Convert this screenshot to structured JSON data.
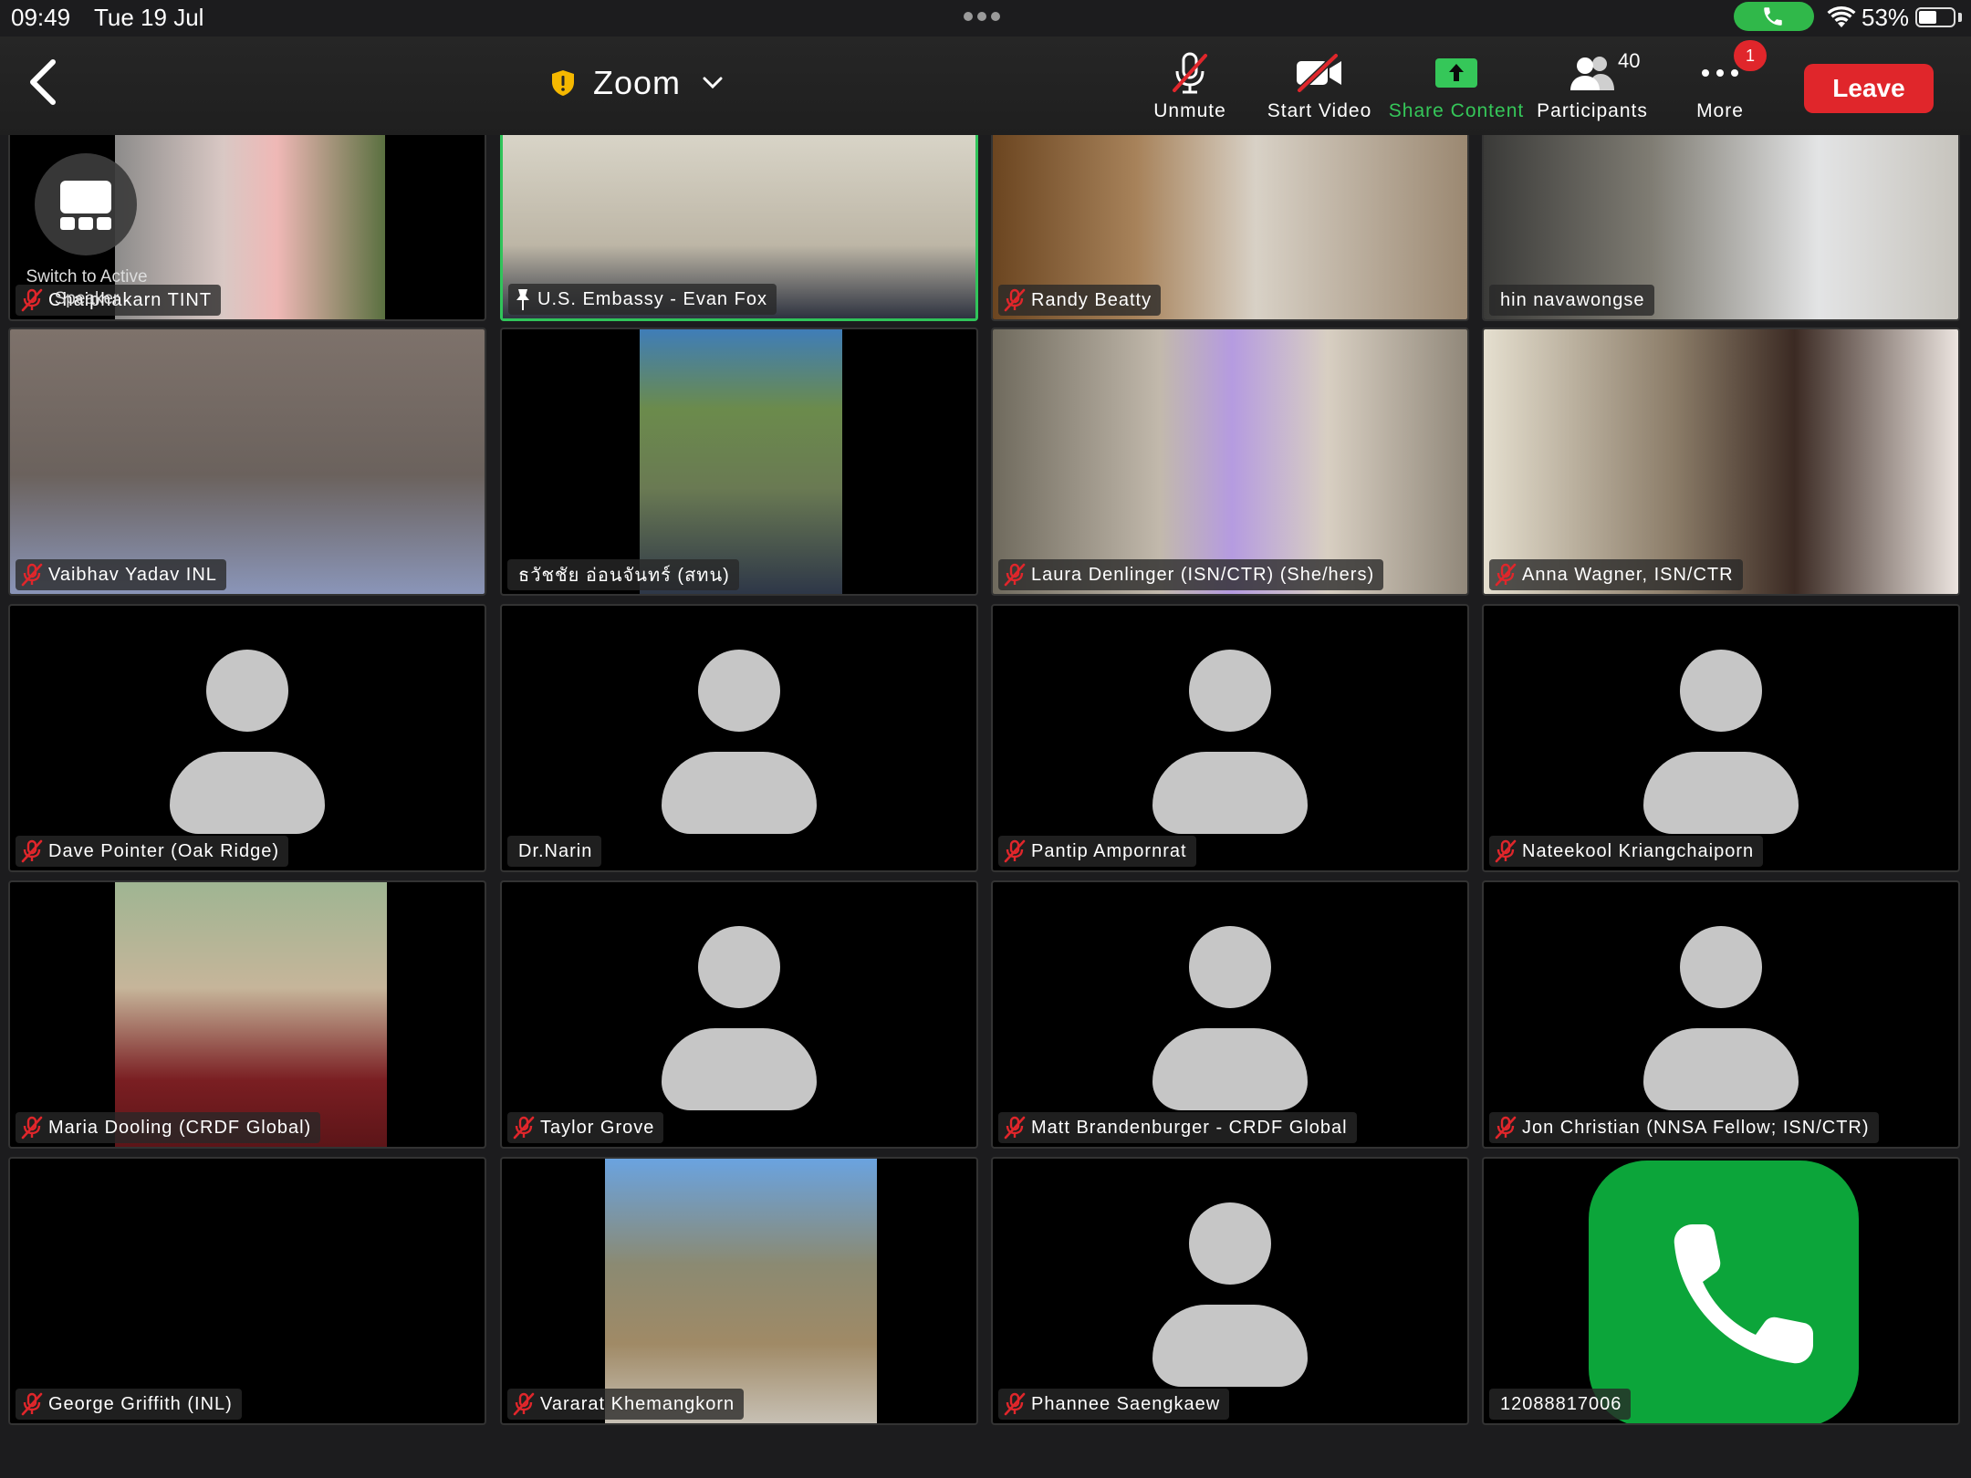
{
  "status_bar": {
    "time": "09:49",
    "date": "Tue 19 Jul",
    "battery": "53%",
    "battery_level": 0.53
  },
  "toolbar": {
    "title": "Zoom",
    "unmute_label": "Unmute",
    "start_video_label": "Start Video",
    "share_content_label": "Share Content",
    "participants_label": "Participants",
    "participants_count": "40",
    "more_label": "More",
    "more_badge": "1",
    "leave_label": "Leave",
    "accent_green": "#35c759",
    "leave_color": "#e0262b"
  },
  "switch_speaker": {
    "label": "Switch to Active Speaker"
  },
  "tiles": [
    {
      "name": "Chaiphakarn TINT",
      "muted": true,
      "kind": "video"
    },
    {
      "name": "U.S. Embassy - Evan Fox",
      "muted": false,
      "kind": "video",
      "active": true
    },
    {
      "name": "Randy Beatty",
      "muted": true,
      "kind": "video"
    },
    {
      "name": "hin navawongse",
      "muted": false,
      "kind": "video"
    },
    {
      "name": "Vaibhav Yadav INL",
      "muted": true,
      "kind": "video"
    },
    {
      "name": "ธวัชชัย อ่อนจันทร์ (สทน)",
      "muted": false,
      "kind": "video"
    },
    {
      "name": "Laura Denlinger (ISN/CTR) (She/hers)",
      "muted": true,
      "kind": "video"
    },
    {
      "name": "Anna Wagner, ISN/CTR",
      "muted": true,
      "kind": "video"
    },
    {
      "name": "Dave Pointer (Oak Ridge)",
      "muted": true,
      "kind": "avatar"
    },
    {
      "name": "Dr.Narin",
      "muted": false,
      "kind": "avatar"
    },
    {
      "name": "Pantip Ampornrat",
      "muted": true,
      "kind": "avatar"
    },
    {
      "name": "Nateekool Kriangchaiporn",
      "muted": true,
      "kind": "avatar"
    },
    {
      "name": "Maria Dooling (CRDF Global)",
      "muted": true,
      "kind": "photo"
    },
    {
      "name": "Taylor Grove",
      "muted": true,
      "kind": "avatar"
    },
    {
      "name": "Matt Brandenburger - CRDF Global",
      "muted": true,
      "kind": "avatar"
    },
    {
      "name": "Jon Christian (NNSA Fellow; ISN/CTR)",
      "muted": true,
      "kind": "avatar"
    },
    {
      "name": "George Griffith (INL)",
      "muted": true,
      "kind": "blank"
    },
    {
      "name": "Vararat Khemangkorn",
      "muted": true,
      "kind": "photo"
    },
    {
      "name": "Phannee Saengkaew",
      "muted": true,
      "kind": "avatar"
    },
    {
      "name": "12088817006",
      "muted": false,
      "kind": "phone"
    }
  ]
}
